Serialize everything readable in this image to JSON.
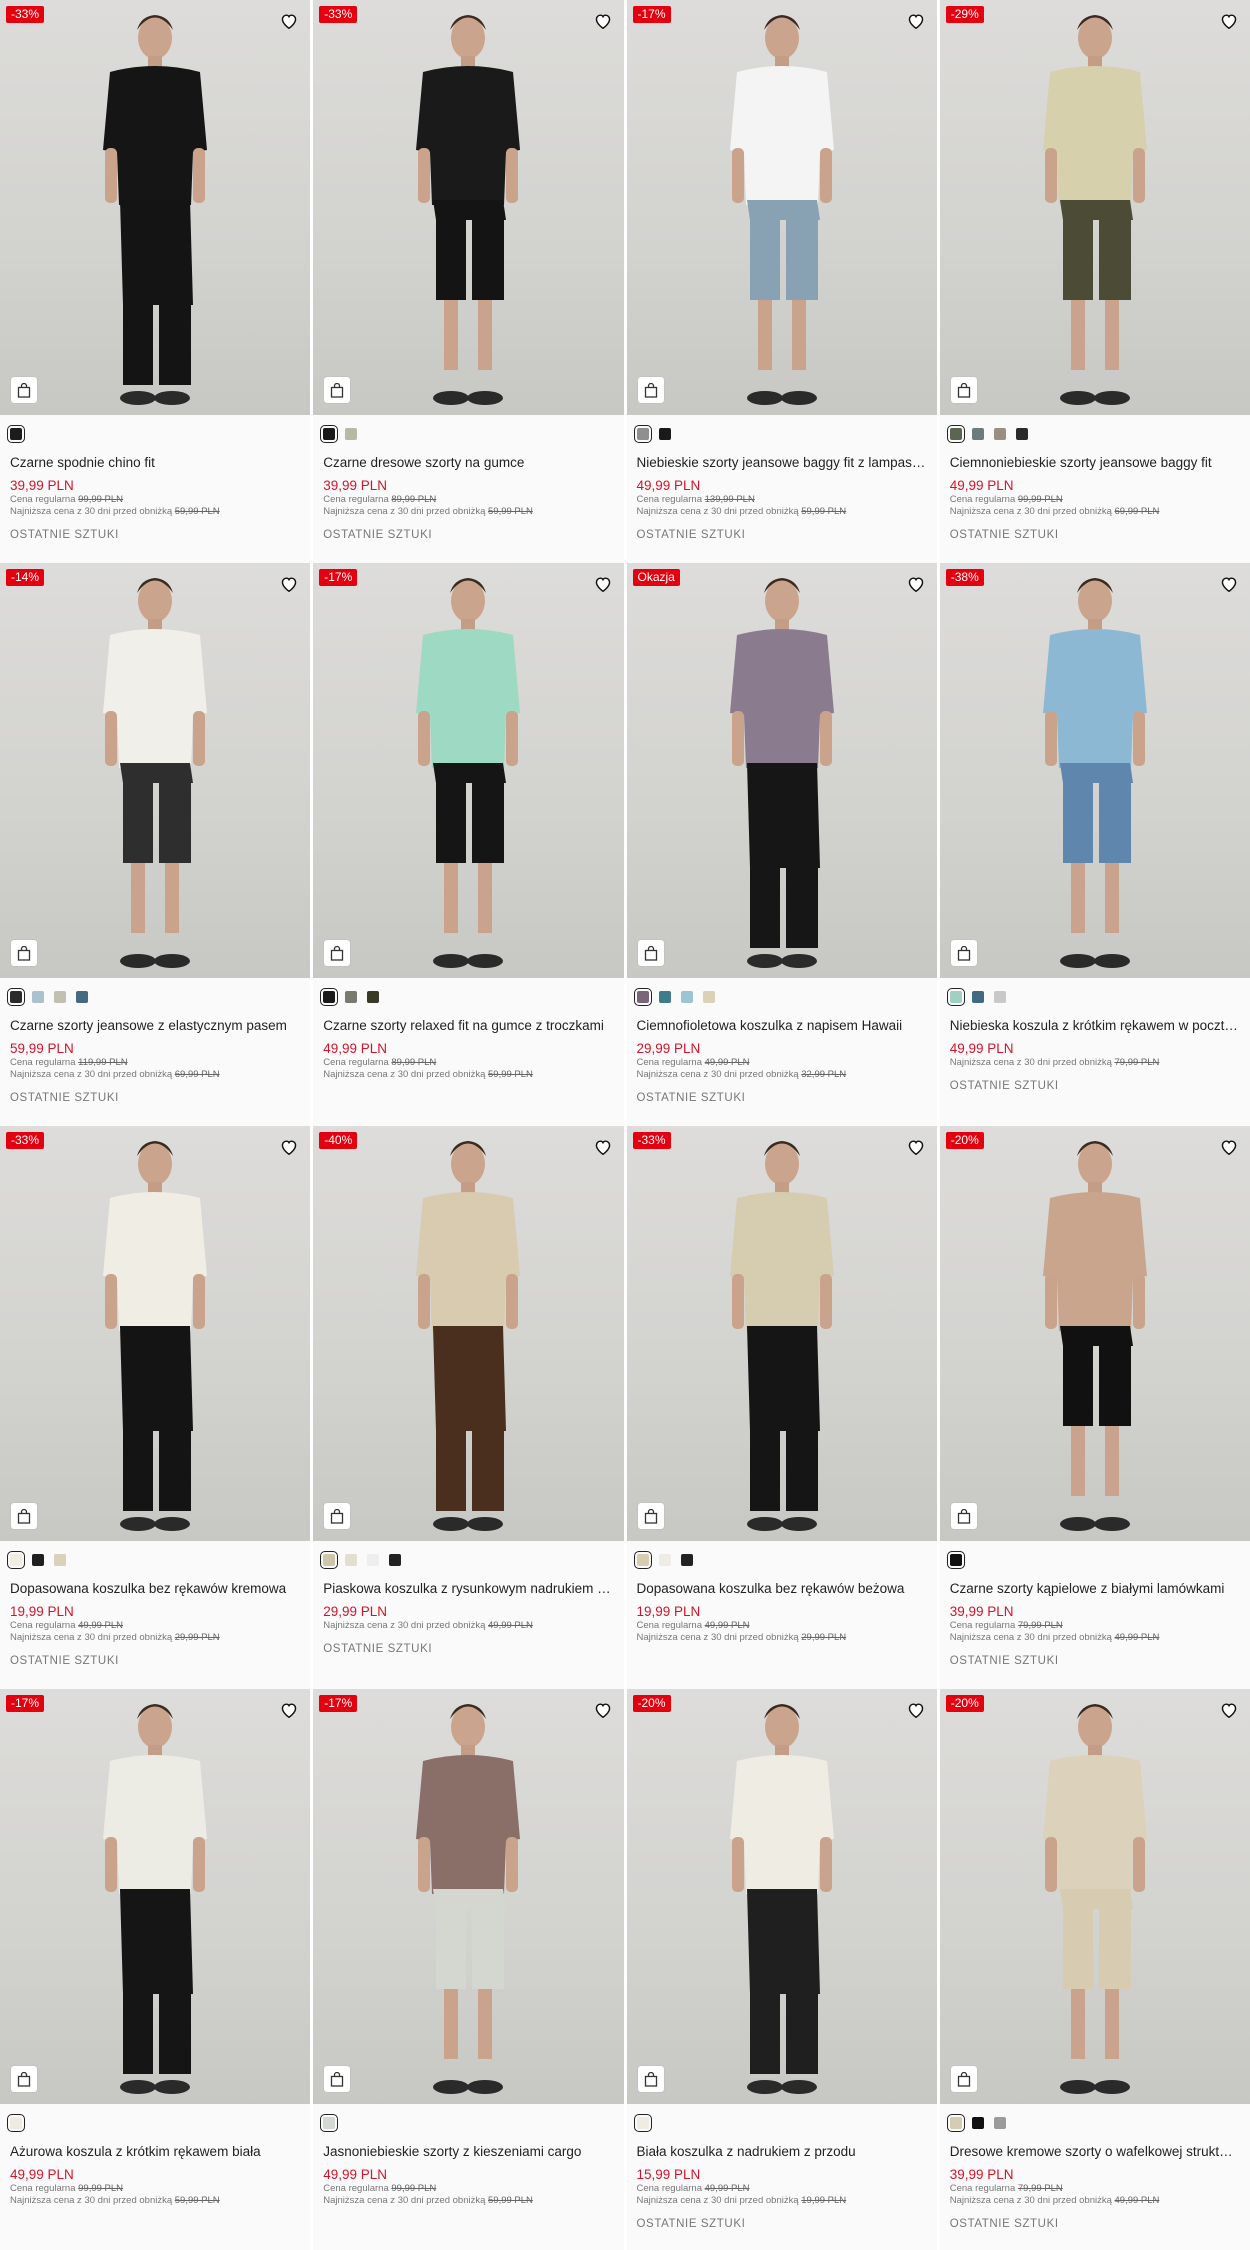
{
  "labels": {
    "regular_prefix": "Cena regularna",
    "lowest_prefix": "Najniższa cena z 30 dni przed obniżką"
  },
  "products": [
    {
      "badge": "-33%",
      "name": "Czarne spodnie chino fit",
      "price": "39,99 PLN",
      "regular": "99,99 PLN",
      "lowest": "59,99 PLN",
      "status": "OSTATNIE SZTUKI",
      "swatches": [
        "#1c1c1c"
      ],
      "top": "#151515",
      "bottom": "#141414",
      "bottomLen": "long"
    },
    {
      "badge": "-33%",
      "name": "Czarne dresowe szorty na gumce",
      "price": "39,99 PLN",
      "regular": "89,99 PLN",
      "lowest": "59,99 PLN",
      "status": "OSTATNIE SZTUKI",
      "swatches": [
        "#1a1a1a",
        "#b7b9a7"
      ],
      "top": "#1a1a1a",
      "bottom": "#141414",
      "bottomLen": "short"
    },
    {
      "badge": "-17%",
      "name": "Niebieskie szorty jeansowe baggy fit z lampasami",
      "price": "49,99 PLN",
      "regular": "139,99 PLN",
      "lowest": "59,99 PLN",
      "status": "OSTATNIE SZTUKI",
      "swatches": [
        "#8f8f8f",
        "#1a1a1a"
      ],
      "top": "#f4f4f4",
      "bottom": "#88a2b4",
      "bottomLen": "short"
    },
    {
      "badge": "-29%",
      "name": "Ciemnoniebieskie szorty jeansowe baggy fit",
      "price": "49,99 PLN",
      "regular": "99,99 PLN",
      "lowest": "69,99 PLN",
      "status": "OSTATNIE SZTUKI",
      "swatches": [
        "#5c6452",
        "#6c7b7c",
        "#9a8e80",
        "#2b2b2b"
      ],
      "top": "#d6d0ad",
      "bottom": "#4c4b36",
      "bottomLen": "short"
    },
    {
      "badge": "-14%",
      "name": "Czarne szorty jeansowe z elastycznym pasem",
      "price": "59,99 PLN",
      "regular": "119,99 PLN",
      "lowest": "69,99 PLN",
      "status": "OSTATNIE SZTUKI",
      "swatches": [
        "#2a2a2a",
        "#a9c2cd",
        "#c2bfb3",
        "#466a82"
      ],
      "top": "#f1efe9",
      "bottom": "#2e2e2e",
      "bottomLen": "short"
    },
    {
      "badge": "-17%",
      "name": "Czarne szorty relaxed fit na gumce z troczkami",
      "price": "49,99 PLN",
      "regular": "89,99 PLN",
      "lowest": "59,99 PLN",
      "status": "",
      "swatches": [
        "#1a1a1a",
        "#777a6c",
        "#3a3a28"
      ],
      "top": "#9ed9c3",
      "bottom": "#151515",
      "bottomLen": "short"
    },
    {
      "badge": "Okazja",
      "name": "Ciemnofioletowa koszulka z napisem Hawaii",
      "price": "29,99 PLN",
      "regular": "49,99 PLN",
      "lowest": "32,99 PLN",
      "status": "OSTATNIE SZTUKI",
      "swatches": [
        "#7a6679",
        "#3f7b8c",
        "#9cc4d3",
        "#d9d2b8"
      ],
      "top": "#8b7b8e",
      "bottom": "#161616",
      "bottomLen": "long"
    },
    {
      "badge": "-38%",
      "name": "Niebieska koszula z krótkim rękawem w pocztówkowy wzór",
      "price": "49,99 PLN",
      "regular": "",
      "lowest": "79,99 PLN",
      "status": "OSTATNIE SZTUKI",
      "swatches": [
        "#9fd0c2",
        "#3f6b80",
        "#c8c8c8"
      ],
      "top": "#8cb8d4",
      "bottom": "#5f86ad",
      "bottomLen": "short"
    },
    {
      "badge": "-33%",
      "name": "Dopasowana koszulka bez rękawów kremowa",
      "price": "19,99 PLN",
      "regular": "49,99 PLN",
      "lowest": "29,99 PLN",
      "status": "OSTATNIE SZTUKI",
      "swatches": [
        "#efece3",
        "#1f1f1f",
        "#d9d2b8"
      ],
      "top": "#f0ede4",
      "bottom": "#141414",
      "bottomLen": "long"
    },
    {
      "badge": "-40%",
      "name": "Piaskowa koszulka z rysunkowym nadrukiem tropikalnym",
      "price": "29,99 PLN",
      "regular": "",
      "lowest": "49,99 PLN",
      "status": "OSTATNIE SZTUKI",
      "swatches": [
        "#cfc5a8",
        "#e2dfcf",
        "#eeeeee",
        "#222222"
      ],
      "top": "#d8cbb0",
      "bottom": "#4a2e1e",
      "bottomLen": "long"
    },
    {
      "badge": "-33%",
      "name": "Dopasowana koszulka bez rękawów beżowa",
      "price": "19,99 PLN",
      "regular": "49,99 PLN",
      "lowest": "29,99 PLN",
      "status": "",
      "swatches": [
        "#d7ceb2",
        "#efece3",
        "#222222"
      ],
      "top": "#d6cdb0",
      "bottom": "#151515",
      "bottomLen": "long"
    },
    {
      "badge": "-20%",
      "name": "Czarne szorty kąpielowe z białymi lamówkami",
      "price": "39,99 PLN",
      "regular": "79,99 PLN",
      "lowest": "49,99 PLN",
      "status": "OSTATNIE SZTUKI",
      "swatches": [
        "#111111"
      ],
      "top": "#c9a58e",
      "bottom": "#111111",
      "bottomLen": "short"
    },
    {
      "badge": "-17%",
      "name": "Ażurowa koszula z krótkim rękawem biała",
      "price": "49,99 PLN",
      "regular": "99,99 PLN",
      "lowest": "59,99 PLN",
      "status": "",
      "swatches": [
        "#eeebe3"
      ],
      "top": "#ecebe4",
      "bottom": "#151515",
      "bottomLen": "long"
    },
    {
      "badge": "-17%",
      "name": "Jasnoniebieskie szorty z kieszeniami cargo",
      "price": "49,99 PLN",
      "regular": "99,99 PLN",
      "lowest": "59,99 PLN",
      "status": "",
      "swatches": [
        "#d4d8d2"
      ],
      "top": "#8a6f68",
      "bottom": "#d3d7d0",
      "bottomLen": "short"
    },
    {
      "badge": "-20%",
      "name": "Biała koszulka z nadrukiem z przodu",
      "price": "15,99 PLN",
      "regular": "49,99 PLN",
      "lowest": "19,99 PLN",
      "status": "OSTATNIE SZTUKI",
      "swatches": [
        "#efece3"
      ],
      "top": "#efece3",
      "bottom": "#1f1f1f",
      "bottomLen": "long"
    },
    {
      "badge": "-20%",
      "name": "Dresowe kremowe szorty o wafelkowej strukturze",
      "price": "39,99 PLN",
      "regular": "79,99 PLN",
      "lowest": "49,99 PLN",
      "status": "OSTATNIE SZTUKI",
      "swatches": [
        "#d4cdb4",
        "#111111",
        "#9b9b9b"
      ],
      "top": "#dcd1ba",
      "bottom": "#d7cbb2",
      "bottomLen": "short"
    }
  ]
}
